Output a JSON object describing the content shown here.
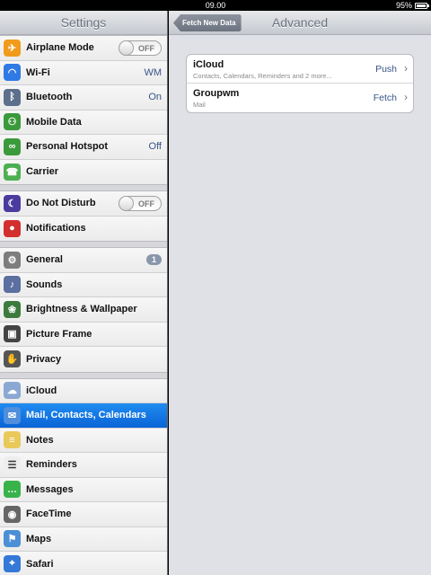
{
  "status": {
    "time": "09.00",
    "battery": "95%"
  },
  "sidebar": {
    "title": "Settings",
    "groups": [
      [
        {
          "label": "Airplane Mode",
          "icon": "airplane-icon",
          "toggle": "OFF"
        },
        {
          "label": "Wi-Fi",
          "icon": "wifi-icon",
          "value": "WM"
        },
        {
          "label": "Bluetooth",
          "icon": "bluetooth-icon",
          "value": "On"
        },
        {
          "label": "Mobile Data",
          "icon": "antenna-icon"
        },
        {
          "label": "Personal Hotspot",
          "icon": "hotspot-icon",
          "value": "Off"
        },
        {
          "label": "Carrier",
          "icon": "phone-icon"
        }
      ],
      [
        {
          "label": "Do Not Disturb",
          "icon": "moon-icon",
          "toggle": "OFF"
        },
        {
          "label": "Notifications",
          "icon": "notifications-icon"
        }
      ],
      [
        {
          "label": "General",
          "icon": "gear-icon",
          "badge": "1"
        },
        {
          "label": "Sounds",
          "icon": "speaker-icon"
        },
        {
          "label": "Brightness & Wallpaper",
          "icon": "flower-icon"
        },
        {
          "label": "Picture Frame",
          "icon": "picture-frame-icon"
        },
        {
          "label": "Privacy",
          "icon": "hand-icon"
        }
      ],
      [
        {
          "label": "iCloud",
          "icon": "cloud-icon"
        },
        {
          "label": "Mail, Contacts, Calendars",
          "icon": "mail-icon",
          "selected": true
        },
        {
          "label": "Notes",
          "icon": "notes-icon"
        },
        {
          "label": "Reminders",
          "icon": "reminders-icon"
        },
        {
          "label": "Messages",
          "icon": "speech-bubble-icon"
        },
        {
          "label": "FaceTime",
          "icon": "video-camera-icon"
        },
        {
          "label": "Maps",
          "icon": "map-icon"
        },
        {
          "label": "Safari",
          "icon": "compass-icon"
        }
      ]
    ]
  },
  "main": {
    "back_label": "Fetch New Data",
    "title": "Advanced",
    "accounts": [
      {
        "name": "iCloud",
        "desc": "Contacts, Calendars, Reminders and 2 more...",
        "mode": "Push"
      },
      {
        "name": "Groupwm",
        "desc": "Mail",
        "mode": "Fetch"
      }
    ]
  },
  "colors": {
    "accent": "#1677e6",
    "value_text": "#385487"
  }
}
